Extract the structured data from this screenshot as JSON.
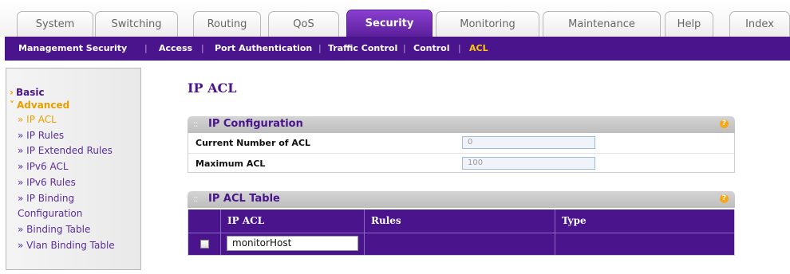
{
  "tabs": [
    {
      "label": "System",
      "active": false
    },
    {
      "label": "Switching",
      "active": false
    },
    {
      "label": "Routing",
      "active": false
    },
    {
      "label": "QoS",
      "active": false
    },
    {
      "label": "Security",
      "active": true
    },
    {
      "label": "Monitoring",
      "active": false
    },
    {
      "label": "Maintenance",
      "active": false
    },
    {
      "label": "Help",
      "active": false
    },
    {
      "label": "Index",
      "active": false
    }
  ],
  "subnav": {
    "items": [
      {
        "label": "Management Security",
        "active": false
      },
      {
        "label": "Access",
        "active": false
      },
      {
        "label": "Port Authentication",
        "active": false
      },
      {
        "label": "Traffic Control",
        "active": false
      },
      {
        "label": "Control",
        "active": false
      },
      {
        "label": "ACL",
        "active": true
      }
    ],
    "separator": "|"
  },
  "sidebar": {
    "basic": "Basic",
    "advanced": "Advanced",
    "items": [
      {
        "label": "» IP ACL",
        "selected": true
      },
      {
        "label": "» IP Rules",
        "selected": false
      },
      {
        "label": "» IP Extended Rules",
        "selected": false
      },
      {
        "label": "» IPv6 ACL",
        "selected": false
      },
      {
        "label": "» IPv6 Rules",
        "selected": false
      },
      {
        "label": "» IP Binding",
        "selected": false
      },
      {
        "label": "Configuration",
        "selected": false
      },
      {
        "label": "» Binding Table",
        "selected": false
      },
      {
        "label": "» Vlan Binding Table",
        "selected": false
      }
    ]
  },
  "main": {
    "title": "IP ACL",
    "ip_config": {
      "title": "IP Configuration",
      "help": "?",
      "rows": [
        {
          "label": "Current Number of ACL",
          "value": "0"
        },
        {
          "label": "Maximum ACL",
          "value": "100"
        }
      ]
    },
    "acl_table": {
      "title": "IP ACL Table",
      "help": "?",
      "columns": [
        "IP ACL",
        "Rules",
        "Type"
      ],
      "new_row": {
        "ip_acl_input": "monitorHost",
        "rules": "",
        "type": ""
      }
    }
  },
  "colors": {
    "accent": "#4a148c",
    "active_tab": "#5b1f9b",
    "highlight": "#ffcc00",
    "help_icon": "#f7a71b"
  }
}
